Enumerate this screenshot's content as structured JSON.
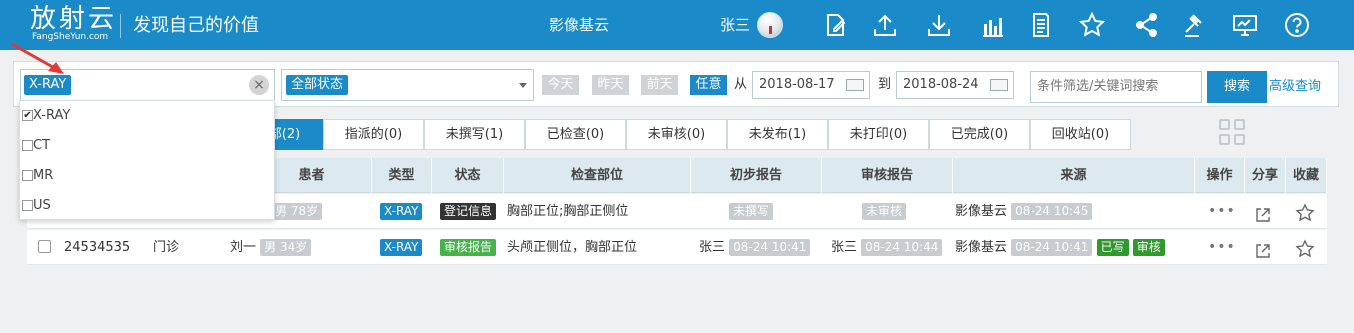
{
  "header": {
    "logo_text": "放射云",
    "logo_subtext": "FangSheYun.com",
    "slogan": "发现自己的价值",
    "center_title": "影像基云",
    "user_name": "张三",
    "icons": [
      "edit-icon",
      "upload-icon",
      "download-icon",
      "bar-chart-icon",
      "document-icon",
      "star-icon",
      "share-icon",
      "gavel-icon",
      "monitor-icon",
      "help-icon"
    ],
    "bg_color": "#1a8bc8"
  },
  "filter": {
    "modality_tag": "X-RAY",
    "clear_glyph": "×",
    "status_value": "全部状态",
    "quick_dates": [
      "今天",
      "昨天",
      "前天",
      "任意"
    ],
    "quick_active": "任意",
    "from_label": "从",
    "date_from": "2018-08-17",
    "to_label": "到",
    "date_to": "2018-08-24",
    "search_placeholder": "条件筛选/关键词搜索",
    "search_button": "搜索",
    "advanced_link": "高级查询"
  },
  "modality_dropdown": {
    "options": [
      {
        "label": "X-RAY",
        "checked": true
      },
      {
        "label": "CT",
        "checked": false
      },
      {
        "label": "MR",
        "checked": false
      },
      {
        "label": "US",
        "checked": false
      }
    ]
  },
  "tabs": [
    {
      "label": "部(2)",
      "active": true
    },
    {
      "label": "指派的(0)",
      "active": false
    },
    {
      "label": "未撰写(1)",
      "active": false
    },
    {
      "label": "已检查(0)",
      "active": false
    },
    {
      "label": "未审核(0)",
      "active": false
    },
    {
      "label": "未发布(1)",
      "active": false
    },
    {
      "label": "未打印(0)",
      "active": false
    },
    {
      "label": "已完成(0)",
      "active": false
    },
    {
      "label": "回收站(0)",
      "active": false
    }
  ],
  "table": {
    "columns": [
      "患者",
      "类型",
      "状态",
      "检查部位",
      "初步报告",
      "审核报告",
      "来源",
      "操作",
      "分享",
      "收藏"
    ],
    "rows": [
      {
        "id": "",
        "visit": "",
        "patient_name": "",
        "patient_meta": "男 78岁",
        "type": "X-RAY",
        "status": "登记信息",
        "status_color": "#333333",
        "body_part": "胸部正位;胸部正侧位",
        "prelim_report": "未撰写",
        "prelim_time": "",
        "review_report": "未审核",
        "review_time": "",
        "source": "影像基云",
        "source_time": "08-24 10:45",
        "extra_badges": []
      },
      {
        "id": "24534535",
        "visit": "门诊",
        "patient_name": "刘一",
        "patient_meta": "男 34岁",
        "type": "X-RAY",
        "status": "审核报告",
        "status_color": "#46b24a",
        "body_part": "头颅正侧位，胸部正位",
        "prelim_report": "张三",
        "prelim_time": "08-24 10:41",
        "review_report": "张三",
        "review_time": "08-24 10:44",
        "source": "影像基云",
        "source_time": "08-24 10:41",
        "extra_badges": [
          "已写",
          "审核"
        ]
      }
    ],
    "ops_glyph": "•••"
  }
}
